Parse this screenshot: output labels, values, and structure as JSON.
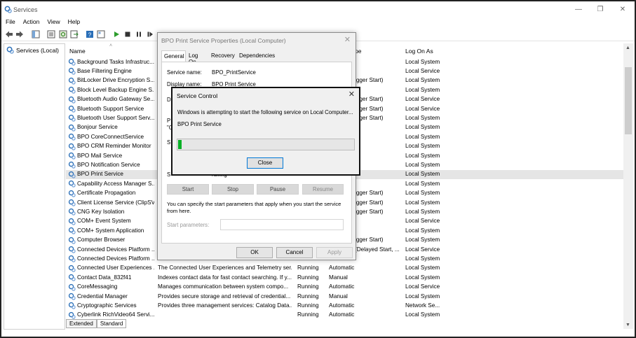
{
  "window": {
    "title": "Services"
  },
  "menu": [
    "File",
    "Action",
    "View",
    "Help"
  ],
  "tree": {
    "root": "Services (Local)"
  },
  "columns": {
    "name": "Name",
    "type_partial": "pe",
    "logon": "Log On As"
  },
  "services": [
    {
      "name": "Background Tasks Infrastruc...",
      "desc": "",
      "status": "",
      "type": "",
      "logon": "Local System"
    },
    {
      "name": "Base Filtering Engine",
      "desc": "",
      "status": "",
      "type": "",
      "logon": "Local Service"
    },
    {
      "name": "BitLocker Drive Encryption S...",
      "desc": "",
      "status": "",
      "type": "igger Start)",
      "logon": "Local System"
    },
    {
      "name": "Block Level Backup Engine S...",
      "desc": "",
      "status": "",
      "type": "",
      "logon": "Local System"
    },
    {
      "name": "Bluetooth Audio Gateway Se...",
      "desc": "",
      "status": "",
      "type": "igger Start)",
      "logon": "Local Service"
    },
    {
      "name": "Bluetooth Support Service",
      "desc": "",
      "status": "",
      "type": "igger Start)",
      "logon": "Local Service"
    },
    {
      "name": "Bluetooth User Support Serv...",
      "desc": "",
      "status": "",
      "type": "igger Start)",
      "logon": "Local System"
    },
    {
      "name": "Bonjour Service",
      "desc": "",
      "status": "",
      "type": "",
      "logon": "Local System"
    },
    {
      "name": "BPO CoreConnectService",
      "desc": "",
      "status": "",
      "type": "",
      "logon": "Local System"
    },
    {
      "name": "BPO CRM Reminder Monitor",
      "desc": "",
      "status": "",
      "type": "",
      "logon": "Local System"
    },
    {
      "name": "BPO Mail Service",
      "desc": "",
      "status": "",
      "type": "",
      "logon": "Local System"
    },
    {
      "name": "BPO Notification Service",
      "desc": "",
      "status": "",
      "type": "",
      "logon": "Local System"
    },
    {
      "name": "BPO Print Service",
      "desc": "",
      "status": "",
      "type": "",
      "logon": "Local System",
      "selected": true
    },
    {
      "name": "Capability Access Manager S...",
      "desc": "",
      "status": "",
      "type": "",
      "logon": "Local System"
    },
    {
      "name": "Certificate Propagation",
      "desc": "",
      "status": "",
      "type": "igger Start)",
      "logon": "Local System"
    },
    {
      "name": "Client License Service (ClipSV...",
      "desc": "",
      "status": "",
      "type": "igger Start)",
      "logon": "Local System"
    },
    {
      "name": "CNG Key Isolation",
      "desc": "",
      "status": "",
      "type": "igger Start)",
      "logon": "Local System"
    },
    {
      "name": "COM+ Event System",
      "desc": "",
      "status": "",
      "type": "",
      "logon": "Local Service"
    },
    {
      "name": "COM+ System Application",
      "desc": "",
      "status": "",
      "type": "",
      "logon": "Local System"
    },
    {
      "name": "Computer Browser",
      "desc": "",
      "status": "",
      "type": "igger Start)",
      "logon": "Local System"
    },
    {
      "name": "Connected Devices Platform ...",
      "desc": "",
      "status": "",
      "type": "(Delayed Start, ...",
      "logon": "Local Service"
    },
    {
      "name": "Connected Devices Platform ...",
      "desc": "",
      "status": "",
      "type": "",
      "logon": "Local System"
    },
    {
      "name": "Connected User Experiences ...",
      "desc": "The Connected User Experiences and Telemetry ser...",
      "status": "Running",
      "type": "Automatic",
      "logon": "Local System"
    },
    {
      "name": "Contact Data_832f41",
      "desc": "Indexes contact data for fast contact searching. If y...",
      "status": "Running",
      "type": "Manual",
      "logon": "Local System"
    },
    {
      "name": "CoreMessaging",
      "desc": "Manages communication between system compo...",
      "status": "Running",
      "type": "Automatic",
      "logon": "Local Service"
    },
    {
      "name": "Credential Manager",
      "desc": "Provides secure storage and retrieval of credential...",
      "status": "Running",
      "type": "Manual",
      "logon": "Local System"
    },
    {
      "name": "Cryptographic Services",
      "desc": "Provides three management services: Catalog Data...",
      "status": "Running",
      "type": "Automatic",
      "logon": "Network Se..."
    },
    {
      "name": "Cyberlink RichVideo64 Servi...",
      "desc": "",
      "status": "Running",
      "type": "Automatic",
      "logon": "Local System"
    }
  ],
  "tabs": {
    "extended": "Extended",
    "standard": "Standard"
  },
  "properties": {
    "title": "BPO Print Service Properties (Local Computer)",
    "tabs": [
      "General",
      "Log On",
      "Recovery",
      "Dependencies"
    ],
    "service_name_label": "Service name:",
    "service_name": "BPO_PrintService",
    "display_name_label": "Display name:",
    "display_name": "BPO Print Service",
    "frag_d": "D",
    "frag_p": "P",
    "frag_quote": "\"C",
    "frag_s": "S",
    "frag_status": "S",
    "frag_status2": "ruiiiiiig",
    "buttons": {
      "start": "Start",
      "stop": "Stop",
      "pause": "Pause",
      "resume": "Resume"
    },
    "hint": "You can specify the start parameters that apply when you start the service from here.",
    "start_params_label": "Start parameters:",
    "ok": "OK",
    "cancel": "Cancel",
    "apply": "Apply"
  },
  "service_control": {
    "title": "Service Control",
    "message": "Windows is attempting to start the following service on Local Computer...",
    "service": "BPO Print Service",
    "progress": 0.02,
    "close": "Close",
    "progress_color": "#06b025"
  }
}
